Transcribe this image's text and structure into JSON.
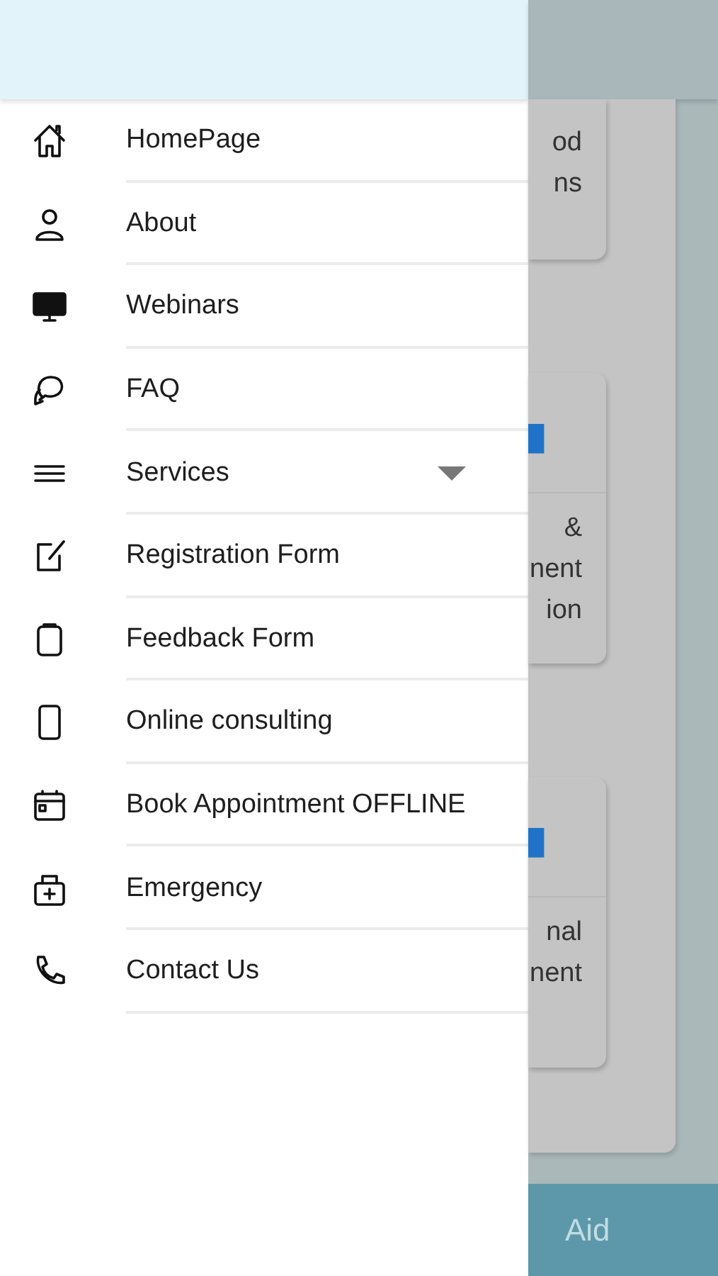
{
  "drawer": {
    "items": [
      {
        "label": "HomePage",
        "kind": "link"
      },
      {
        "label": "About",
        "kind": "link"
      },
      {
        "label": "Webinars",
        "kind": "link"
      },
      {
        "label": "FAQ",
        "kind": "link"
      },
      {
        "label": "Services",
        "kind": "expandable"
      },
      {
        "label": "Registration Form",
        "kind": "link"
      },
      {
        "label": "Feedback Form",
        "kind": "link"
      },
      {
        "label": "Online consulting",
        "kind": "link"
      },
      {
        "label": "Book Appointment OFFLINE",
        "kind": "link"
      },
      {
        "label": "Emergency",
        "kind": "link"
      },
      {
        "label": "Contact Us",
        "kind": "link"
      }
    ]
  },
  "background": {
    "cards": [
      {
        "lines": [
          "od",
          "ns"
        ]
      },
      {
        "lines": [
          "&",
          "nent",
          "ion"
        ]
      },
      {
        "lines": [
          "nal",
          "nent"
        ]
      }
    ],
    "bottom_bar": {
      "label": "Aid"
    }
  }
}
